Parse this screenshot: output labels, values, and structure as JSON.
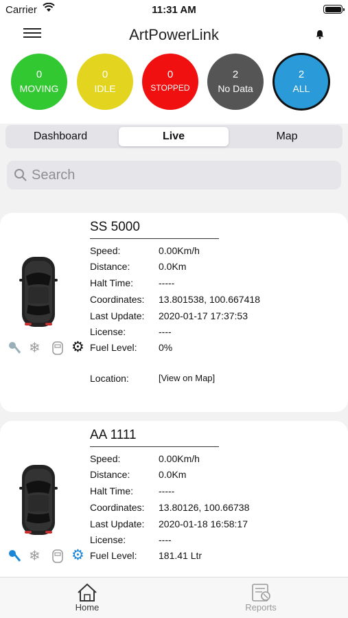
{
  "status_bar": {
    "carrier": "Carrier",
    "time": "11:31 AM"
  },
  "nav": {
    "title": "ArtPowerLink"
  },
  "filters": [
    {
      "count": "0",
      "label": "MOVING",
      "color": "#32c832"
    },
    {
      "count": "0",
      "label": "IDLE",
      "color": "#e3d51f"
    },
    {
      "count": "0",
      "label": "STOPPED",
      "color": "#f01010"
    },
    {
      "count": "2",
      "label": "No Data",
      "color": "#555555"
    },
    {
      "count": "2",
      "label": "ALL",
      "color": "#2a9ad8"
    }
  ],
  "tabs": [
    "Dashboard",
    "Live",
    "Map"
  ],
  "active_tab": "Live",
  "search": {
    "placeholder": "Search"
  },
  "field_labels": {
    "speed": "Speed:",
    "distance": "Distance:",
    "halt_time": "Halt Time:",
    "coordinates": "Coordinates:",
    "last_update": "Last Update:",
    "license": "License:",
    "fuel_level": "Fuel Level:",
    "location": "Location:"
  },
  "vehicles": [
    {
      "name": "SS 5000",
      "speed": "0.00Km/h",
      "distance": "0.0Km",
      "halt_time": "-----",
      "coordinates": "13.801538, 100.667418",
      "last_update": "2020-01-17 17:37:53",
      "license": "----",
      "fuel_level": "0%",
      "location": "[View on Map]",
      "status_icons": [
        "key-icon",
        "snowflake-icon",
        "door-icon",
        "gear-icon"
      ],
      "icon_color": "#9ab0b8"
    },
    {
      "name": "AA 1111",
      "speed": "0.00Km/h",
      "distance": "0.0Km",
      "halt_time": "-----",
      "coordinates": "13.80126, 100.66738",
      "last_update": "2020-01-18 16:58:17",
      "license": "----",
      "fuel_level": "181.41 Ltr",
      "status_icons": [
        "key-icon",
        "snowflake-icon",
        "door-icon",
        "gear-icon"
      ],
      "icon_color": "#1a86d8"
    }
  ],
  "tabbar": {
    "home": "Home",
    "reports": "Reports"
  }
}
